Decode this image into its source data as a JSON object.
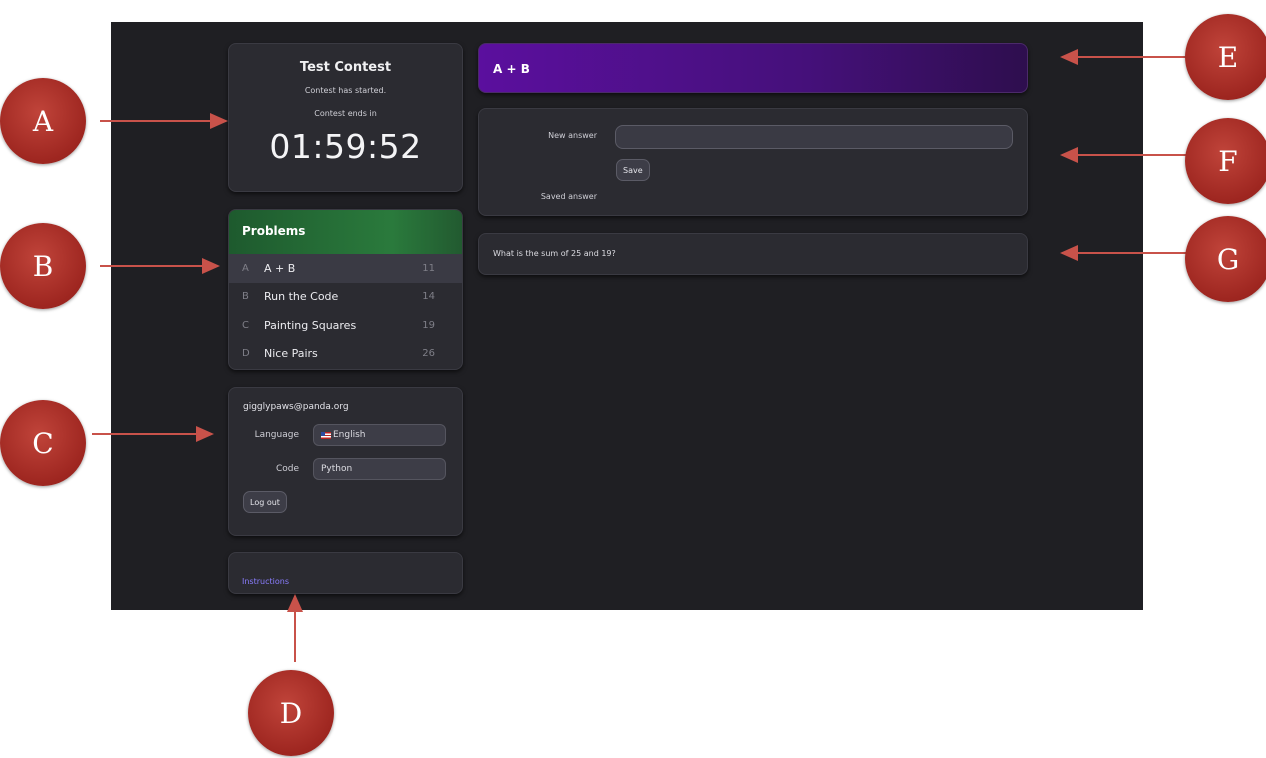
{
  "contest": {
    "title": "Test Contest",
    "status": "Contest has started.",
    "ends_label": "Contest ends in",
    "timer": "01:59:52"
  },
  "problems": {
    "header": "Problems",
    "items": [
      {
        "letter": "A",
        "name": "A + B",
        "score": "11",
        "active": true
      },
      {
        "letter": "B",
        "name": "Run the Code",
        "score": "14",
        "active": false
      },
      {
        "letter": "C",
        "name": "Painting Squares",
        "score": "19",
        "active": false
      },
      {
        "letter": "D",
        "name": "Nice Pairs",
        "score": "26",
        "active": false
      }
    ]
  },
  "user": {
    "email": "gigglypaws@panda.org",
    "language_label": "Language",
    "language_value": "English",
    "code_label": "Code",
    "code_value": "Python",
    "logout_label": "Log out"
  },
  "instructions": {
    "link_label": "Instructions"
  },
  "problem": {
    "title": "A + B",
    "new_answer_label": "New answer",
    "save_label": "Save",
    "saved_answer_label": "Saved answer",
    "statement": "What is the sum of 25 and 19?"
  },
  "annotations": [
    "A",
    "B",
    "C",
    "D",
    "E",
    "F",
    "G"
  ],
  "colors": {
    "background": "#1f1f23",
    "card": "#2b2b31",
    "problems_header": "#2a7a3c",
    "title_bar": "#5b0f9e",
    "link": "#8a7dff",
    "callout": "#9e2620",
    "arrow": "#c8524a"
  }
}
